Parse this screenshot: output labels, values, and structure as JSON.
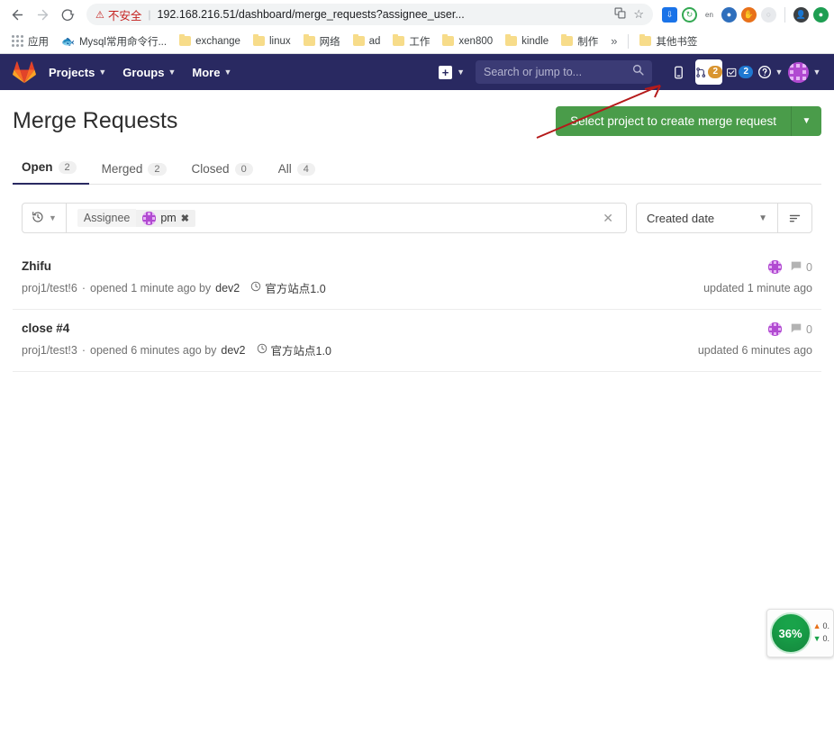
{
  "browser": {
    "nav": {
      "back": "back-arrow",
      "forward": "forward-arrow",
      "reload": "reload-icon"
    },
    "omnibox": {
      "security_warning": "不安全",
      "url": "192.168.216.51/dashboard/merge_requests?assignee_user...",
      "translate_icon": "translate-icon",
      "star_icon": "star-icon"
    },
    "bookmarks": [
      {
        "label": "应用",
        "icon": "apps-grid-icon"
      },
      {
        "label": "Mysql常用命令行...",
        "icon": "mysql-icon"
      },
      {
        "label": "exchange",
        "icon": "folder-icon"
      },
      {
        "label": "linux",
        "icon": "folder-icon"
      },
      {
        "label": "网络",
        "icon": "folder-icon"
      },
      {
        "label": "ad",
        "icon": "folder-icon"
      },
      {
        "label": "工作",
        "icon": "folder-icon"
      },
      {
        "label": "xen800",
        "icon": "folder-icon"
      },
      {
        "label": "kindle",
        "icon": "folder-icon"
      },
      {
        "label": "制作",
        "icon": "folder-icon"
      }
    ],
    "bookmarks_overflow": "»",
    "other_bookmarks": "其他书签",
    "extensions": [
      {
        "name": "download-extension-icon",
        "color": "#1a73e8"
      },
      {
        "name": "sync-extension-icon",
        "color": "#34a853"
      },
      {
        "name": "translate-extension-icon",
        "color": "#5f6368"
      },
      {
        "name": "adblock-extension-icon",
        "color": "#2f6fbd"
      },
      {
        "name": "hand-extension-icon",
        "color": "#e8711a"
      },
      {
        "name": "generic-extension-icon",
        "color": "#bdc1c6"
      },
      {
        "name": "profile-icon",
        "color": "#3c4043"
      },
      {
        "name": "status-icon",
        "color": "#1e9e52"
      }
    ]
  },
  "gitlab_nav": {
    "logo": "gitlab-logo",
    "links": [
      {
        "label": "Projects"
      },
      {
        "label": "Groups"
      },
      {
        "label": "More"
      }
    ],
    "create_new": "plus-icon",
    "search": {
      "placeholder": "Search or jump to...",
      "value": "",
      "icon": "search-icon"
    },
    "issues": {
      "icon": "issues-icon"
    },
    "merge_requests": {
      "icon": "merge-request-icon",
      "badge": "2",
      "badge_color": "#d99530",
      "active": true
    },
    "todos": {
      "icon": "todos-icon",
      "badge": "2",
      "badge_color": "#1f78d1"
    },
    "help": {
      "icon": "help-icon"
    },
    "avatar": {
      "icon": "user-avatar",
      "color": "#b14ad1"
    }
  },
  "page": {
    "title": "Merge Requests",
    "create_button": "Select project to create merge request",
    "create_button_caret": "dropdown-caret"
  },
  "tabs": [
    {
      "label": "Open",
      "count": "2",
      "active": true
    },
    {
      "label": "Merged",
      "count": "2",
      "active": false
    },
    {
      "label": "Closed",
      "count": "0",
      "active": false
    },
    {
      "label": "All",
      "count": "4",
      "active": false
    }
  ],
  "filters": {
    "recent_searches_icon": "history-icon",
    "token": {
      "key": "Assignee",
      "value": "pm",
      "avatar_color": "#b14ad1",
      "remove": "✖"
    },
    "clear_all": "✕",
    "sort": {
      "value": "Created date",
      "direction_icon": "sort-descending-icon"
    }
  },
  "merge_requests": [
    {
      "title": "Zhifu",
      "reference": "proj1/test!6",
      "separator": "·",
      "opened": "opened 1 minute ago by",
      "author": "dev2",
      "milestone": "官方站点1.0",
      "comments": "0",
      "updated": "updated 1 minute ago",
      "assignee_color": "#b14ad1"
    },
    {
      "title": "close #4",
      "reference": "proj1/test!3",
      "separator": "·",
      "opened": "opened 6 minutes ago by",
      "author": "dev2",
      "milestone": "官方站点1.0",
      "comments": "0",
      "updated": "updated 6 minutes ago",
      "assignee_color": "#b14ad1"
    }
  ],
  "network_monitor": {
    "percent": "36%",
    "upload": "0.",
    "download": "0."
  },
  "annotation": {
    "color": "#b51a1a",
    "description": "red-arrow-pointing-to-merge-requests-icon"
  }
}
